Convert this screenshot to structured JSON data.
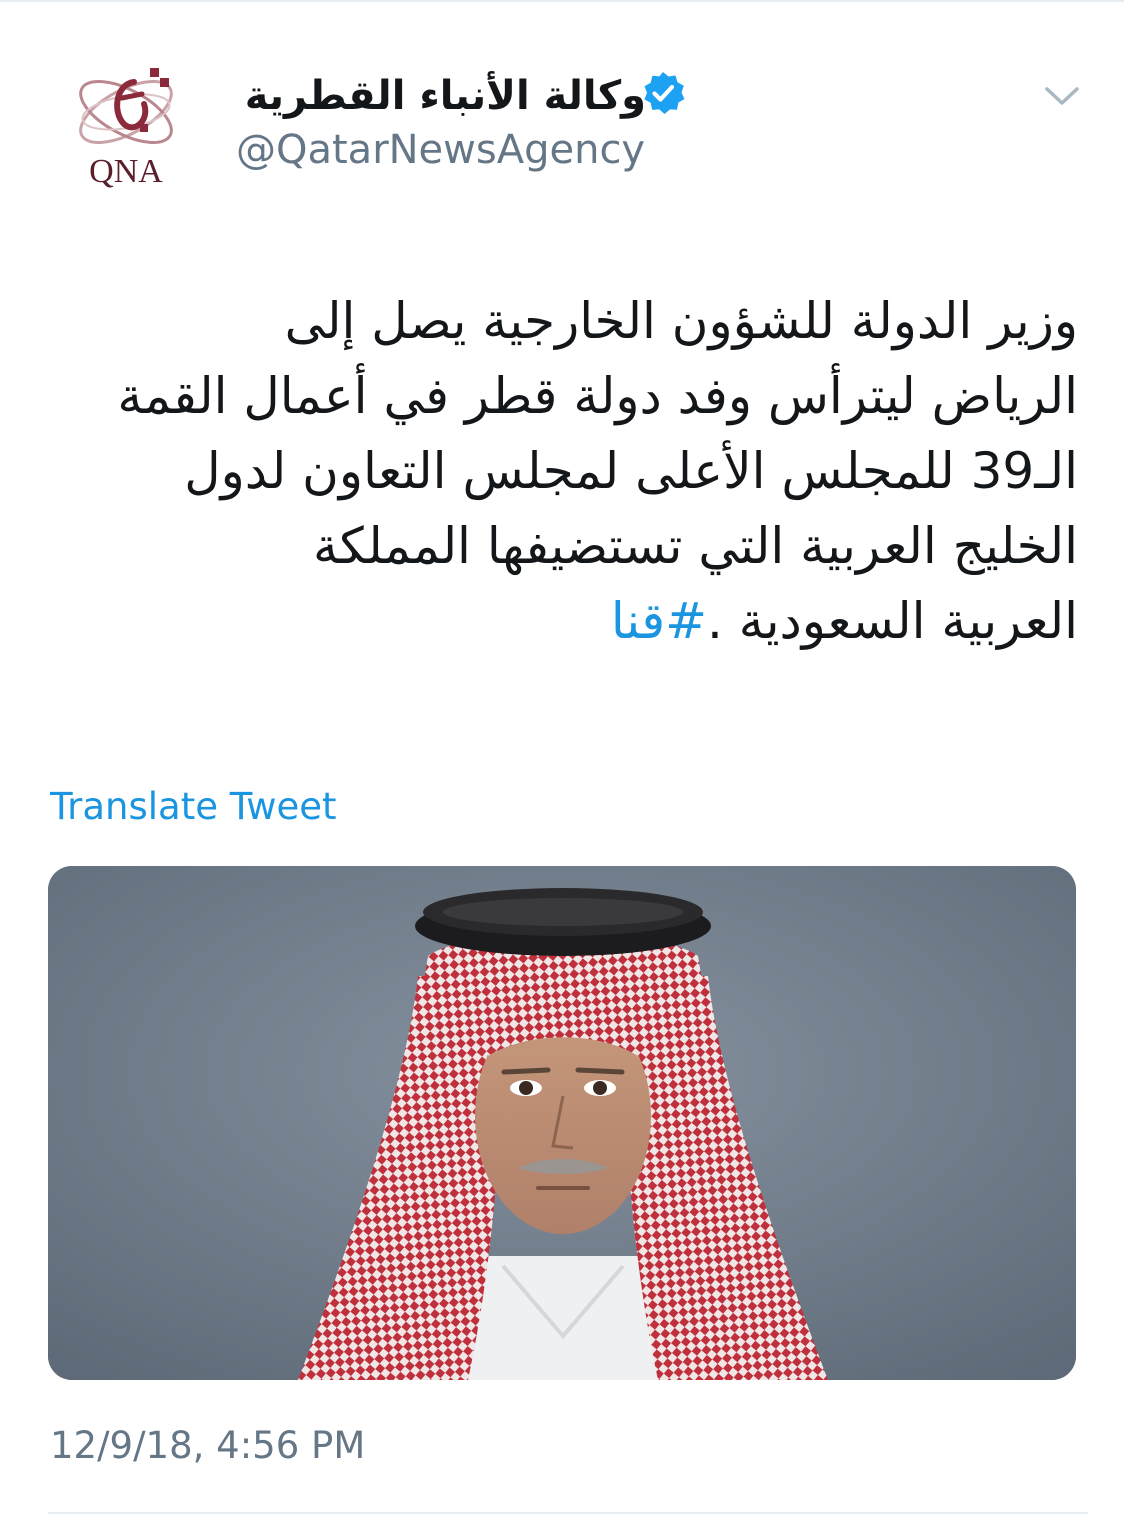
{
  "tweet": {
    "author": {
      "display_name": "وكالة الأنباء القطرية",
      "handle": "@QatarNewsAgency",
      "avatar_text": "QNA",
      "verified": true
    },
    "text_lines": [
      "وزير الدولة للشؤون الخارجية يصل إلى",
      "الرياض ليترأس وفد دولة قطر في أعمال القمة",
      "الـ39 للمجلس الأعلى لمجلس التعاون لدول",
      "الخليج العربية التي تستضيفها المملكة",
      "العربية السعودية ."
    ],
    "hashtag": "#قنا",
    "translate_label": "Translate Tweet",
    "timestamp": "12/9/18, 4:56 PM",
    "colors": {
      "link": "#1b95e0",
      "secondary_text": "#657786",
      "verified_badge": "#1da1f2",
      "qna_brand": "#8b2a3a"
    },
    "icons": {
      "verified": "verified-badge-icon",
      "menu": "chevron-down-icon"
    }
  }
}
